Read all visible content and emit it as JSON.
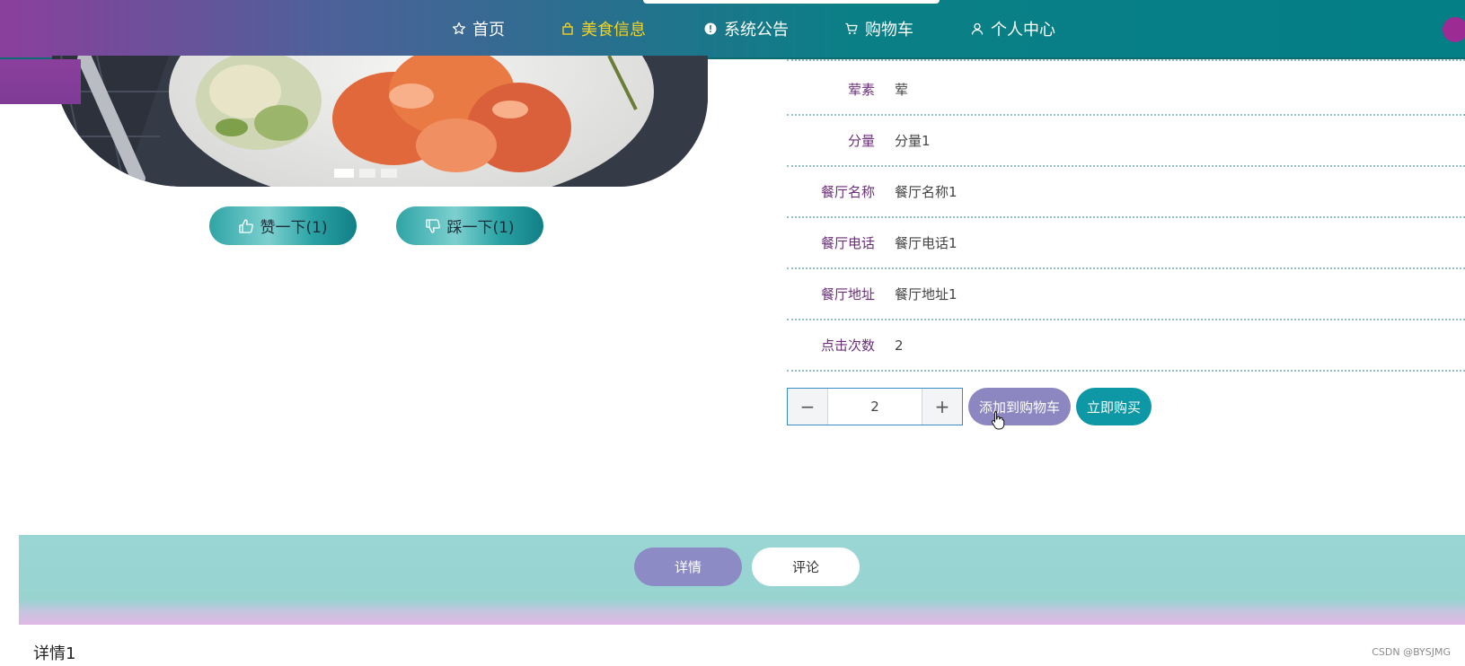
{
  "nav": {
    "items": [
      {
        "label": "首页",
        "icon": "star-icon",
        "active": false
      },
      {
        "label": "美食信息",
        "icon": "bag-icon",
        "active": true
      },
      {
        "label": "系统公告",
        "icon": "alert-icon",
        "active": false
      },
      {
        "label": "购物车",
        "icon": "cart-icon",
        "active": false
      },
      {
        "label": "个人中心",
        "icon": "user-icon",
        "active": false
      }
    ],
    "active_color": "#f5d320"
  },
  "votes": {
    "like_label": "赞一下(1)",
    "dislike_label": "踩一下(1)"
  },
  "info": {
    "rows": [
      {
        "label": "荤素",
        "value": "荤"
      },
      {
        "label": "分量",
        "value": "分量1"
      },
      {
        "label": "餐厅名称",
        "value": "餐厅名称1"
      },
      {
        "label": "餐厅电话",
        "value": "餐厅电话1"
      },
      {
        "label": "餐厅地址",
        "value": "餐厅地址1"
      },
      {
        "label": "点击次数",
        "value": "2"
      }
    ]
  },
  "purchase": {
    "quantity": "2",
    "minus_symbol": "−",
    "plus_symbol": "+",
    "add_to_cart_label": "添加到购物车",
    "buy_now_label": "立即购买"
  },
  "tabs": {
    "detail_label": "详情",
    "comment_label": "评论"
  },
  "detail_content": "详情1",
  "watermark": "CSDN @BYSJMG"
}
